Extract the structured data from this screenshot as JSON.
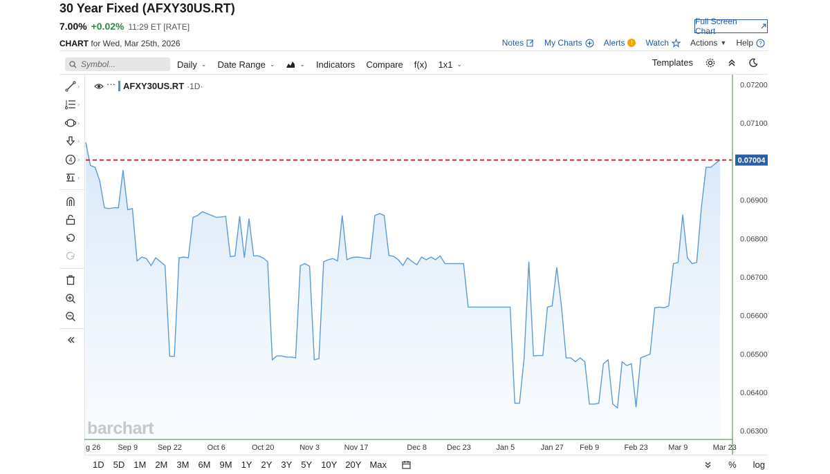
{
  "header": {
    "title": "30 Year Fixed (AFXY30US.RT)",
    "last": "7.00%",
    "change": "+0.02%",
    "time": "11:29 ET [RATE]",
    "full_screen": "Full Screen Chart",
    "chart_label": "CHART",
    "chart_for": "for Wed, Mar 25th, 2026"
  },
  "top_links": {
    "notes": "Notes",
    "my_charts": "My Charts",
    "alerts": "Alerts",
    "watch": "Watch",
    "actions": "Actions",
    "help": "Help"
  },
  "toolbar": {
    "symbol_placeholder": "Symbol...",
    "interval": "Daily",
    "date_range": "Date Range",
    "indicators": "Indicators",
    "compare": "Compare",
    "fx": "f(x)",
    "layout": "1x1",
    "templates": "Templates"
  },
  "legend": {
    "symbol": "AFXY30US.RT",
    "period": "·1D·",
    "prefix": "···"
  },
  "watermark": "barchart",
  "bottom": {
    "timeframes": [
      "1D",
      "5D",
      "1M",
      "2M",
      "3M",
      "6M",
      "9M",
      "1Y",
      "2Y",
      "3Y",
      "5Y",
      "10Y",
      "20Y",
      "Max"
    ],
    "percent": "%",
    "log": "log"
  },
  "colors": {
    "line": "#5b9bd5",
    "area_top": "#d6e6f8",
    "ref_line": "#d62728",
    "accent": "#1f5aa6",
    "positive": "#2e8b3e"
  },
  "chart_data": {
    "type": "area",
    "ylim": [
      0.06278,
      0.07226
    ],
    "y_ticks": [
      "0.07200",
      "0.07100",
      "0.06900",
      "0.06800",
      "0.06700",
      "0.06600",
      "0.06500",
      "0.06400",
      "0.06300"
    ],
    "current_value": "0.07004",
    "x_tick_labels": [
      "g 26",
      "Sep 9",
      "Sep 22",
      "Oct 6",
      "Oct 20",
      "Nov 3",
      "Nov 17",
      "Dec 8",
      "Dec 23",
      "Jan 5",
      "Jan 27",
      "Feb 9",
      "Feb 23",
      "Mar 9",
      "Mar 23"
    ],
    "x_tick_index": [
      0,
      9,
      18,
      28,
      38,
      48,
      58,
      71,
      80,
      90,
      100,
      108,
      118,
      127,
      137
    ],
    "series": [
      {
        "values": [
          0.0705,
          0.0699,
          0.06985,
          0.0695,
          0.0688,
          0.06878,
          0.0688,
          0.0688,
          0.06978,
          0.06875,
          0.06878,
          0.06742,
          0.06752,
          0.06748,
          0.0673,
          0.0675,
          0.0674,
          0.0673,
          0.06494,
          0.06494,
          0.0675,
          0.06752,
          0.0675,
          0.06855,
          0.0686,
          0.0687,
          0.06865,
          0.0686,
          0.06855,
          0.06856,
          0.06858,
          0.06753,
          0.06755,
          0.06858,
          0.0675,
          0.06852,
          0.06755,
          0.06755,
          0.0675,
          0.0674,
          0.06485,
          0.06495,
          0.06495,
          0.06492,
          0.06492,
          0.0649,
          0.0673,
          0.06735,
          0.06728,
          0.06485,
          0.06488,
          0.0674,
          0.06745,
          0.06748,
          0.06742,
          0.0686,
          0.06745,
          0.0675,
          0.06752,
          0.06751,
          0.06749,
          0.06748,
          0.0686,
          0.06865,
          0.0686,
          0.06756,
          0.06754,
          0.06745,
          0.0673,
          0.0675,
          0.0674,
          0.06732,
          0.06752,
          0.06745,
          0.06752,
          0.06745,
          0.06755,
          0.06735,
          0.06735,
          0.06735,
          0.06735,
          0.06735,
          0.06622,
          0.06622,
          0.06622,
          0.06622,
          0.06622,
          0.06622,
          0.06622,
          0.06622,
          0.06622,
          0.06622,
          0.06372,
          0.06372,
          0.0649,
          0.0674,
          0.06495,
          0.06496,
          0.06496,
          0.06622,
          0.06625,
          0.06725,
          0.06623,
          0.0649,
          0.0649,
          0.0648,
          0.0649,
          0.0648,
          0.0637,
          0.0637,
          0.06372,
          0.06475,
          0.06485,
          0.0637,
          0.0636,
          0.0648,
          0.0647,
          0.06475,
          0.06362,
          0.0649,
          0.06495,
          0.065,
          0.0662,
          0.06622,
          0.0662,
          0.06625,
          0.06735,
          0.06738,
          0.06862,
          0.0675,
          0.06735,
          0.06738,
          0.0688,
          0.06985,
          0.06985,
          0.06995,
          0.07004
        ]
      }
    ]
  }
}
